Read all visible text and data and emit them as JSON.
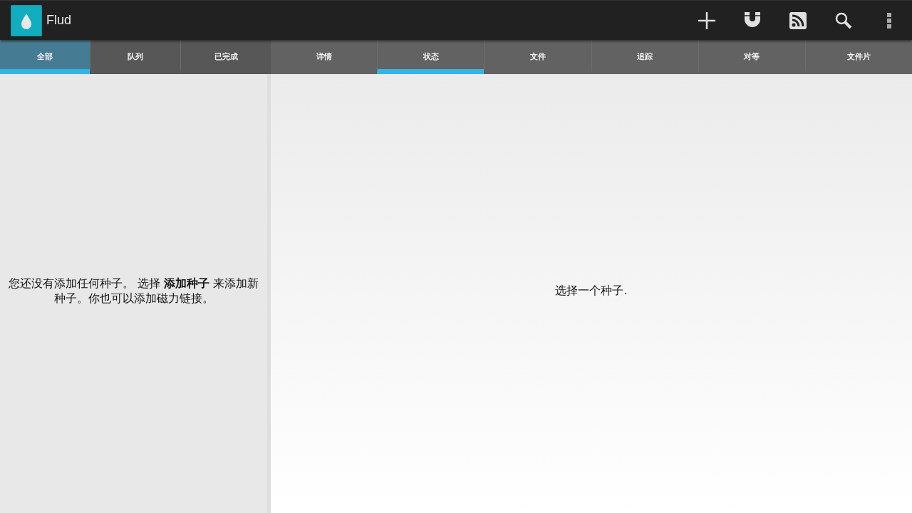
{
  "app_bar": {
    "title": "Flud",
    "actions": [
      {
        "kind": "add"
      },
      {
        "kind": "magnet"
      },
      {
        "kind": "rss"
      },
      {
        "kind": "search"
      },
      {
        "kind": "overflow"
      }
    ]
  },
  "list_tabs": [
    {
      "label": "全部",
      "selected": true
    },
    {
      "label": "队列",
      "selected": false
    },
    {
      "label": "已完成",
      "selected": false
    }
  ],
  "detail_tabs": [
    {
      "label": "详情",
      "selected": false
    },
    {
      "label": "状态",
      "selected": true
    },
    {
      "label": "文件",
      "selected": false
    },
    {
      "label": "追踪",
      "selected": false
    },
    {
      "label": "对等",
      "selected": false
    },
    {
      "label": "文件片",
      "selected": false
    }
  ],
  "list_panel": {
    "empty_message": "您还没有添加任何种子。 选择 **添加种子** 来添加新种子。你也可以添加磁力链接。"
  },
  "detail_panel": {
    "empty_message": "选择一个种子."
  }
}
